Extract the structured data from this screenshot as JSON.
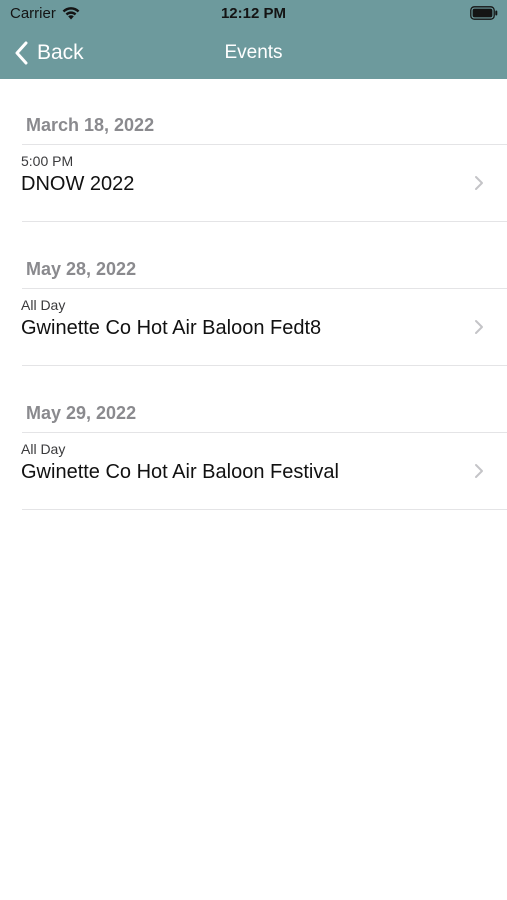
{
  "status_bar": {
    "carrier": "Carrier",
    "time": "12:12 PM",
    "wifi_icon": "wifi-icon",
    "battery_icon": "battery-icon"
  },
  "nav": {
    "back_label": "Back",
    "back_icon": "chevron-left-icon",
    "title": "Events",
    "bar_color": "#6d9a9d"
  },
  "sections": [
    {
      "date": "March 18, 2022",
      "events": [
        {
          "time": "5:00 PM",
          "title": "DNOW 2022"
        }
      ]
    },
    {
      "date": "May 28, 2022",
      "events": [
        {
          "time": "All Day",
          "title": "Gwinette Co Hot Air Baloon Fedt8"
        }
      ]
    },
    {
      "date": "May 29, 2022",
      "events": [
        {
          "time": "All Day",
          "title": "Gwinette Co Hot Air Baloon Festival"
        }
      ]
    }
  ]
}
